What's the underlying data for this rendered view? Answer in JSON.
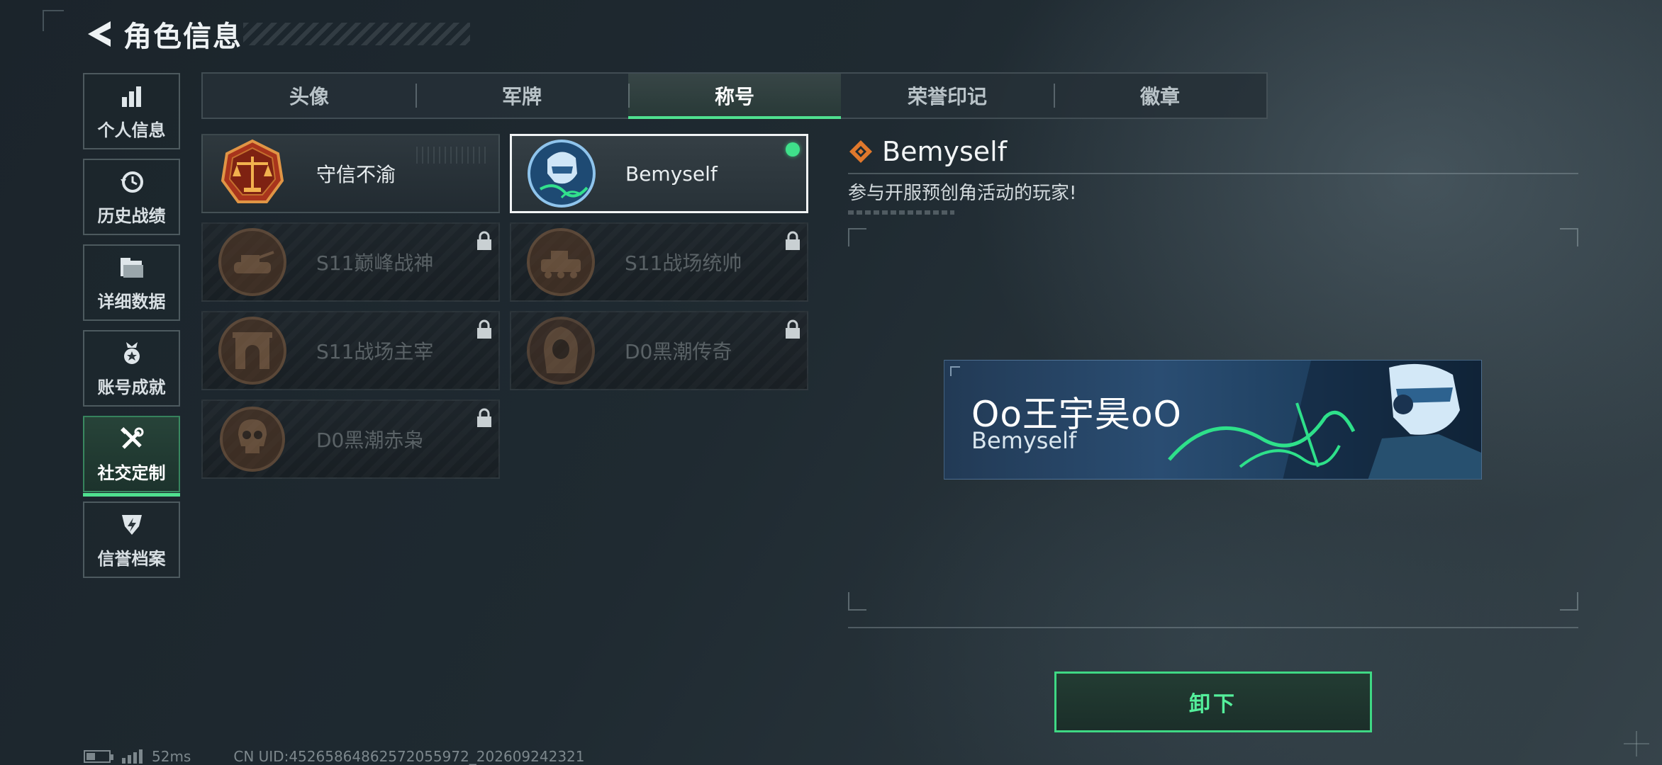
{
  "header": {
    "title": "角色信息"
  },
  "sidebar": {
    "items": [
      {
        "label": "个人信息",
        "icon": "bar-chart-icon"
      },
      {
        "label": "历史战绩",
        "icon": "history-clock-icon"
      },
      {
        "label": "详细数据",
        "icon": "folder-icon"
      },
      {
        "label": "账号成就",
        "icon": "medal-icon"
      },
      {
        "label": "社交定制",
        "icon": "tools-icon",
        "active": true
      },
      {
        "label": "信誉档案",
        "icon": "shield-bolt-icon"
      }
    ]
  },
  "tabs": [
    {
      "label": "头像"
    },
    {
      "label": "军牌"
    },
    {
      "label": "称号",
      "active": true
    },
    {
      "label": "荣誉印记"
    },
    {
      "label": "徽章"
    }
  ],
  "titles": [
    {
      "label": "守信不渝",
      "locked": false,
      "icon": "justice-scales-emblem-icon"
    },
    {
      "label": "Bemyself",
      "locked": false,
      "selected": true,
      "equipped": true,
      "icon": "soldier-signature-emblem-icon"
    },
    {
      "label": "S11巅峰战神",
      "locked": true,
      "icon": "tank-emblem-icon"
    },
    {
      "label": "S11战场统帅",
      "locked": true,
      "icon": "armored-vehicle-emblem-icon"
    },
    {
      "label": "S11战场主宰",
      "locked": true,
      "icon": "arch-emblem-icon"
    },
    {
      "label": "D0黑潮传奇",
      "locked": true,
      "icon": "hooded-figure-emblem-icon"
    },
    {
      "label": "D0黑潮赤枭",
      "locked": true,
      "icon": "skull-emblem-icon"
    }
  ],
  "detail": {
    "title": "Bemyself",
    "description": "参与开服预创角活动的玩家!",
    "nameplate": {
      "player_name": "Oo王宇昊oO",
      "title": "Bemyself"
    }
  },
  "actions": {
    "unequip_label": "卸下"
  },
  "status": {
    "ping": "52ms",
    "uid": "CN UID:4526586486257205597​2_202609242321"
  },
  "colors": {
    "accent": "#4fe08f",
    "orange": "#e0782c"
  }
}
